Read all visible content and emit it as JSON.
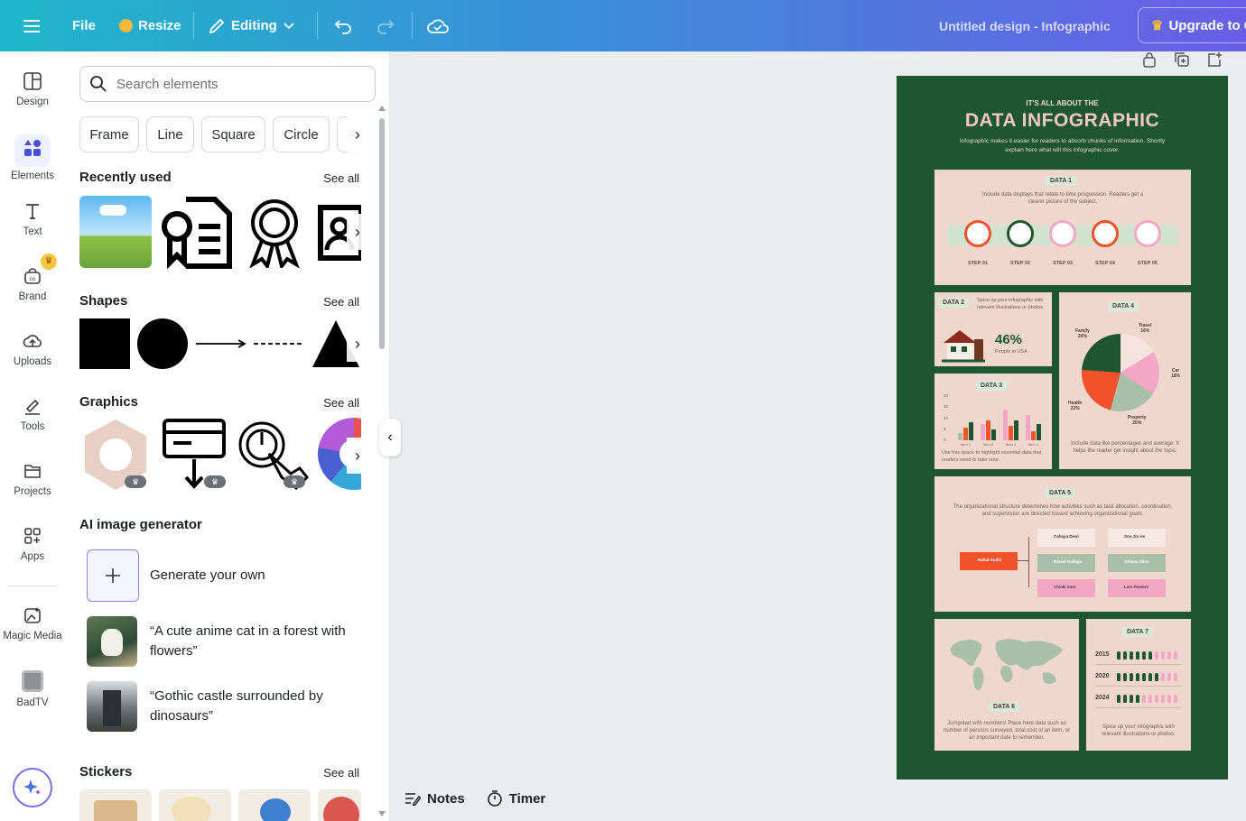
{
  "topbar": {
    "menu_icon": "hamburger-icon",
    "file": "File",
    "resize": "Resize",
    "editing": "Editing",
    "title": "Untitled design - Infographic",
    "upgrade": "Upgrade to C"
  },
  "rail": {
    "items": [
      {
        "label": "Design",
        "icon": "design-icon"
      },
      {
        "label": "Elements",
        "icon": "elements-icon"
      },
      {
        "label": "Text",
        "icon": "text-icon"
      },
      {
        "label": "Brand",
        "icon": "brand-icon"
      },
      {
        "label": "Uploads",
        "icon": "cloud-upload-icon"
      },
      {
        "label": "Tools",
        "icon": "pen-tool-icon"
      },
      {
        "label": "Projects",
        "icon": "folder-icon"
      },
      {
        "label": "Apps",
        "icon": "apps-icon"
      },
      {
        "label": "Magic Media",
        "icon": "magic-media-icon"
      },
      {
        "label": "BadTV",
        "icon": "badtv-icon"
      }
    ]
  },
  "panel": {
    "search_placeholder": "Search elements",
    "chips": [
      "Frame",
      "Line",
      "Square",
      "Circle",
      "A"
    ],
    "recently_used": "Recently used",
    "shapes": "Shapes",
    "graphics": "Graphics",
    "see_all": "See all",
    "ai_title": "AI image generator",
    "generate": "Generate your own",
    "prompt1": "“A cute anime cat in a forest with flowers”",
    "prompt2": "“Gothic castle surrounded by dinosaurs”",
    "stickers": "Stickers"
  },
  "bottom": {
    "notes": "Notes",
    "timer": "Timer"
  },
  "infographic": {
    "kicker": "IT'S ALL ABOUT THE",
    "title": "DATA INFOGRAPHIC",
    "subtitle": "Infographic makes it easier for readers to absorb chunks of information. Shortly explain here what will this infographic cover.",
    "data1": {
      "tag": "DATA 1",
      "text": "Include data displays that relate to time progression. Readers get a clearer picture of the subject.",
      "steps": [
        "STEP 01",
        "STEP 02",
        "STEP 03",
        "STEP 04",
        "STEP 05"
      ]
    },
    "data2": {
      "tag": "DATA 2",
      "text": "Spice up your infographic with relevant illustrations or photos.",
      "value": "46%",
      "caption": "People in USA"
    },
    "data3": {
      "tag": "DATA 3",
      "yticks": [
        "20",
        "15",
        "10",
        "5",
        "0"
      ],
      "xticks": [
        "Item 1",
        "Item 2",
        "Item 3",
        "Item 4"
      ],
      "text": "Use this space to highlight essential data that readers need to take note."
    },
    "data4": {
      "tag": "DATA 4",
      "text": "Include data like percentages and average. It helps the reader get insight about the topic.",
      "slices": [
        {
          "label": "Family",
          "value": "24%",
          "color": "#1e5631"
        },
        {
          "label": "Travel",
          "value": "16%",
          "color": "#f6e3e0"
        },
        {
          "label": "Car",
          "value": "18%",
          "color": "#f4a7c4"
        },
        {
          "label": "Property",
          "value": "20%",
          "color": "#a9bfa8"
        },
        {
          "label": "Health",
          "value": "22%",
          "color": "#f0532b"
        }
      ]
    },
    "data5": {
      "tag": "DATA 5",
      "text": "The organizational structure determines how activities such as task allocation, coordination, and supervision are directed toward achieving organizational goals.",
      "root": "Rahul Sudhi",
      "nodes": [
        "Cahaya Dewi",
        "Soo Jin Ae",
        "Daniel Gallego",
        "Juliana Silva",
        "Chiaki Sato",
        "Lars Peeters"
      ]
    },
    "data6": {
      "tag": "DATA 6",
      "text": "Jumpstart with numbers! Place here data such as number of persons surveyed, total cost of an item, or an important date to remember."
    },
    "data7": {
      "tag": "DATA 7",
      "years": [
        "2015",
        "2020",
        "2024"
      ],
      "filled": [
        6,
        7,
        4
      ],
      "text": "Spice up your infographic with relevant illustrations or photos."
    }
  }
}
